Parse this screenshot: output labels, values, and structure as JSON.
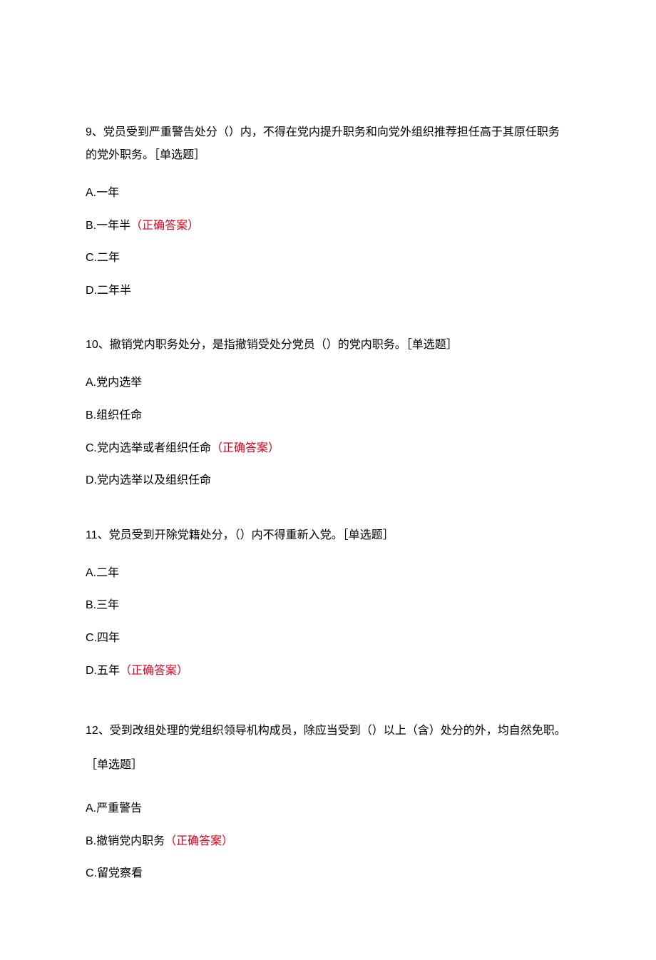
{
  "questions": [
    {
      "num": "9",
      "text": "、党员受到严重警告处分（）内，不得在党内提升职务和向党外组织推荐担任高于其原任职务的党外职务。［单选题］",
      "options": [
        {
          "label": "A.",
          "text": "一年",
          "correct": false
        },
        {
          "label": "B.",
          "text": "一年半",
          "correct": true
        },
        {
          "label": "C.",
          "text": "二年",
          "correct": false
        },
        {
          "label": "D.",
          "text": "二年半",
          "correct": false
        }
      ]
    },
    {
      "num": "10",
      "text": "、撤销党内职务处分，是指撤销受处分党员（）的党内职务。［单选题］",
      "options": [
        {
          "label": "A.",
          "text": "党内选举",
          "correct": false
        },
        {
          "label": "B.",
          "text": "组织任命",
          "correct": false
        },
        {
          "label": "C.",
          "text": "党内选举或者组织任命",
          "correct": true
        },
        {
          "label": "D.",
          "text": "党内选举以及组织任命",
          "correct": false
        }
      ]
    },
    {
      "num": "11",
      "text": "、党员受到开除党籍处分，（）内不得重新入党。［单选题］",
      "options": [
        {
          "label": "A.",
          "text": "二年",
          "correct": false
        },
        {
          "label": "B.",
          "text": "三年",
          "correct": false
        },
        {
          "label": "C.",
          "text": "四年",
          "correct": false
        },
        {
          "label": "D.",
          "text": "五年",
          "correct": true
        }
      ]
    },
    {
      "num": "12",
      "text": "、受到改组处理的党组织领导机构成员，除应当受到（）以上（含）处分的外，均自然免职。［单选题］",
      "options": [
        {
          "label": "A.",
          "text": "严重警告",
          "correct": false
        },
        {
          "label": "B.",
          "text": "撤销党内职务",
          "correct": true
        },
        {
          "label": "C.",
          "text": "留党察看",
          "correct": false
        }
      ]
    }
  ],
  "correctLabel": "（正确答案）"
}
